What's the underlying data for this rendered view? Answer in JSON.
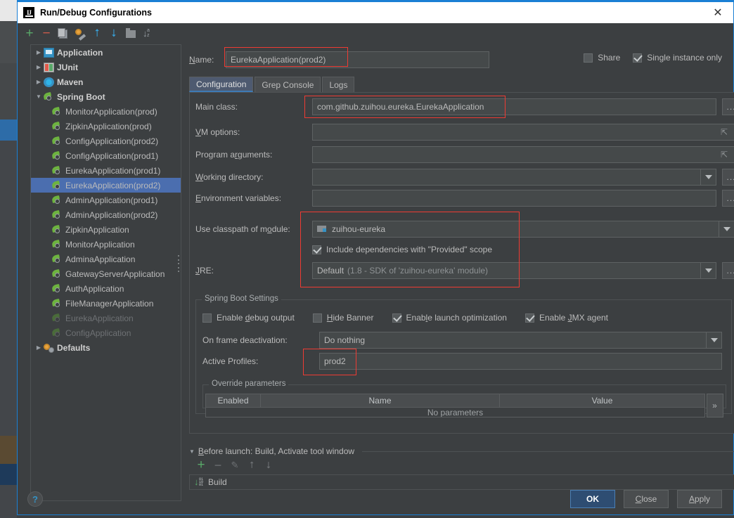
{
  "window": {
    "title": "Run/Debug Configurations",
    "logo_icon": "intellij-idea-logo-icon",
    "close_icon": "close-icon"
  },
  "toolbar": {
    "items": [
      {
        "name": "add-configuration-button",
        "icon": "plus-icon",
        "glyph": "+"
      },
      {
        "name": "remove-configuration-button",
        "icon": "minus-icon",
        "glyph": "−"
      },
      {
        "name": "copy-configuration-button",
        "icon": "copy-icon",
        "glyph": ""
      },
      {
        "name": "edit-templates-button",
        "icon": "wrench-gear-icon",
        "glyph": ""
      },
      {
        "name": "move-up-button",
        "icon": "arrow-up-icon",
        "glyph": "⬆"
      },
      {
        "name": "move-down-button",
        "icon": "arrow-down-icon",
        "glyph": "⬇"
      },
      {
        "name": "create-folder-button",
        "icon": "folder-icon",
        "glyph": ""
      },
      {
        "name": "sort-configurations-button",
        "icon": "sort-alphabetical-icon",
        "glyph": "↓"
      }
    ]
  },
  "tree": {
    "items": [
      {
        "label": "Application",
        "icon": "application-icon",
        "level": 0,
        "expandable": true,
        "expanded": false,
        "selected": false,
        "dim": false
      },
      {
        "label": "JUnit",
        "icon": "junit-icon",
        "level": 0,
        "expandable": true,
        "expanded": false,
        "selected": false,
        "dim": false
      },
      {
        "label": "Maven",
        "icon": "maven-icon",
        "level": 0,
        "expandable": true,
        "expanded": false,
        "selected": false,
        "dim": false
      },
      {
        "label": "Spring Boot",
        "icon": "spring-boot-icon",
        "level": 0,
        "expandable": true,
        "expanded": true,
        "selected": false,
        "dim": false
      },
      {
        "label": "MonitorApplication(prod)",
        "icon": "spring-boot-icon",
        "level": 1,
        "expandable": false,
        "expanded": false,
        "selected": false,
        "dim": false
      },
      {
        "label": "ZipkinApplication(prod)",
        "icon": "spring-boot-icon",
        "level": 1,
        "expandable": false,
        "expanded": false,
        "selected": false,
        "dim": false
      },
      {
        "label": "ConfigApplication(prod2)",
        "icon": "spring-boot-icon",
        "level": 1,
        "expandable": false,
        "expanded": false,
        "selected": false,
        "dim": false
      },
      {
        "label": "ConfigApplication(prod1)",
        "icon": "spring-boot-icon",
        "level": 1,
        "expandable": false,
        "expanded": false,
        "selected": false,
        "dim": false
      },
      {
        "label": "EurekaApplication(prod1)",
        "icon": "spring-boot-icon",
        "level": 1,
        "expandable": false,
        "expanded": false,
        "selected": false,
        "dim": false
      },
      {
        "label": "EurekaApplication(prod2)",
        "icon": "spring-boot-icon",
        "level": 1,
        "expandable": false,
        "expanded": false,
        "selected": true,
        "dim": false
      },
      {
        "label": "AdminApplication(prod1)",
        "icon": "spring-boot-icon",
        "level": 1,
        "expandable": false,
        "expanded": false,
        "selected": false,
        "dim": false
      },
      {
        "label": "AdminApplication(prod2)",
        "icon": "spring-boot-icon",
        "level": 1,
        "expandable": false,
        "expanded": false,
        "selected": false,
        "dim": false
      },
      {
        "label": "ZipkinApplication",
        "icon": "spring-boot-icon",
        "level": 1,
        "expandable": false,
        "expanded": false,
        "selected": false,
        "dim": false
      },
      {
        "label": "MonitorApplication",
        "icon": "spring-boot-icon",
        "level": 1,
        "expandable": false,
        "expanded": false,
        "selected": false,
        "dim": false
      },
      {
        "label": "AdminaApplication",
        "icon": "spring-boot-icon",
        "level": 1,
        "expandable": false,
        "expanded": false,
        "selected": false,
        "dim": false
      },
      {
        "label": "GatewayServerApplication",
        "icon": "spring-boot-icon",
        "level": 1,
        "expandable": false,
        "expanded": false,
        "selected": false,
        "dim": false
      },
      {
        "label": "AuthApplication",
        "icon": "spring-boot-icon",
        "level": 1,
        "expandable": false,
        "expanded": false,
        "selected": false,
        "dim": false
      },
      {
        "label": "FileManagerApplication",
        "icon": "spring-boot-icon",
        "level": 1,
        "expandable": false,
        "expanded": false,
        "selected": false,
        "dim": false
      },
      {
        "label": "EurekaApplication",
        "icon": "spring-boot-icon",
        "level": 1,
        "expandable": false,
        "expanded": false,
        "selected": false,
        "dim": true
      },
      {
        "label": "ConfigApplication",
        "icon": "spring-boot-icon",
        "level": 1,
        "expandable": false,
        "expanded": false,
        "selected": false,
        "dim": true
      },
      {
        "label": "Defaults",
        "icon": "defaults-gears-icon",
        "level": 0,
        "expandable": true,
        "expanded": false,
        "selected": false,
        "dim": false
      }
    ]
  },
  "name_row": {
    "label": "Name:",
    "value": "EurekaApplication(prod2)",
    "highlighted": true
  },
  "options": {
    "share": {
      "label": "Share",
      "checked": false
    },
    "single_instance": {
      "label": "Single instance only",
      "checked": true
    }
  },
  "tabs": [
    {
      "label": "Configuration",
      "active": true
    },
    {
      "label": "Grep Console",
      "active": false
    },
    {
      "label": "Logs",
      "active": false
    }
  ],
  "config": {
    "main_class": {
      "label": "Main class:",
      "value": "com.github.zuihou.eureka.EurekaApplication",
      "browse_icon": "ellipsis-icon",
      "browse_label": "...",
      "highlighted": true
    },
    "vm_options": {
      "label": "VM options:",
      "value": "",
      "expand_icon": "expand-arrows-icon"
    },
    "program_arguments": {
      "label": "Program arguments:",
      "value": "",
      "expand_icon": "expand-arrows-icon"
    },
    "working_directory": {
      "label": "Working directory:",
      "value": "",
      "dropdown_icon": "chevron-down-icon",
      "browse_label": "..."
    },
    "environment_variables": {
      "label": "Environment variables:",
      "value": "",
      "browse_label": "..."
    },
    "use_classpath_of_module": {
      "label": "Use classpath of module:",
      "value": "zuihou-eureka",
      "module_icon": "module-icon",
      "dropdown_icon": "chevron-down-icon",
      "highlighted": true
    },
    "include_provided": {
      "label": "Include dependencies with \"Provided\" scope",
      "checked": true
    },
    "jre": {
      "label": "JRE:",
      "value": "Default",
      "value_hint": "(1.8 - SDK of 'zuihou-eureka' module)",
      "dropdown_icon": "chevron-down-icon",
      "browse_label": "..."
    }
  },
  "spring_boot_settings": {
    "title": "Spring Boot Settings",
    "checkboxes": [
      {
        "label": "Enable debug output",
        "checked": false
      },
      {
        "label": "Hide Banner",
        "checked": false
      },
      {
        "label": "Enable launch optimization",
        "checked": true
      },
      {
        "label": "Enable JMX agent",
        "checked": true
      }
    ],
    "on_frame_deactivation": {
      "label": "On frame deactivation:",
      "value": "Do nothing",
      "dropdown_icon": "chevron-down-icon"
    },
    "active_profiles": {
      "label": "Active Profiles:",
      "value": "prod2",
      "highlighted": true
    },
    "override_parameters": {
      "title": "Override parameters",
      "columns": [
        "Enabled",
        "Name",
        "Value"
      ],
      "empty_text": "No parameters",
      "expand_label": "»"
    }
  },
  "before_launch": {
    "title": "Before launch: Build, Activate tool window",
    "twisty_icon": "chevron-down-icon",
    "toolbar": [
      {
        "name": "add-task-button",
        "icon": "plus-icon",
        "glyph": "+"
      },
      {
        "name": "remove-task-button",
        "icon": "minus-icon",
        "glyph": "−"
      },
      {
        "name": "edit-task-button",
        "icon": "pencil-icon",
        "glyph": "✎"
      },
      {
        "name": "move-task-up-button",
        "icon": "arrow-up-icon",
        "glyph": "⬆"
      },
      {
        "name": "move-task-down-button",
        "icon": "arrow-down-icon",
        "glyph": "⬇"
      }
    ],
    "tasks": [
      {
        "label": "Build",
        "icon": "build-icon"
      }
    ]
  },
  "footer": {
    "help_label": "?",
    "help_icon": "help-icon",
    "buttons": [
      {
        "label": "OK",
        "primary": true,
        "name": "ok-button"
      },
      {
        "label": "Close",
        "primary": false,
        "name": "close-button"
      },
      {
        "label": "Apply",
        "primary": false,
        "name": "apply-button"
      }
    ]
  },
  "colors": {
    "dialog_bg": "#3c3f41",
    "field_bg": "#45494a",
    "selection": "#4b6eaf",
    "accent_border": "#1a7fd4",
    "annotation_red": "#ee3b33",
    "text": "#bbbbbb",
    "primary_button": "#2e4d72"
  }
}
